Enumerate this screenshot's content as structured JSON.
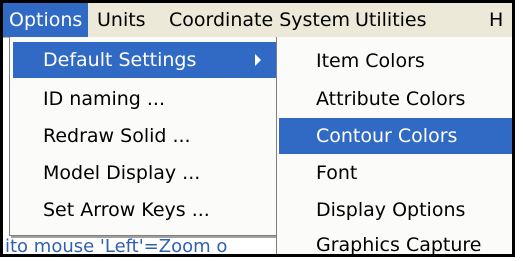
{
  "menubar": {
    "items": [
      {
        "label": "Options"
      },
      {
        "label": "Units"
      },
      {
        "label": "Coordinate System"
      },
      {
        "label": "Utilities"
      },
      {
        "label": "H"
      }
    ]
  },
  "options_menu": {
    "items": [
      {
        "label": "Default Settings"
      },
      {
        "label": "ID naming ..."
      },
      {
        "label": "Redraw Solid ..."
      },
      {
        "label": "Model Display ..."
      },
      {
        "label": "Set Arrow Keys ..."
      }
    ]
  },
  "default_settings_submenu": {
    "items": [
      {
        "label": "Item Colors"
      },
      {
        "label": "Attribute Colors"
      },
      {
        "label": "Contour Colors"
      },
      {
        "label": "Font"
      },
      {
        "label": "Display Options"
      },
      {
        "label": "Graphics Capture"
      }
    ]
  },
  "statusbar": {
    "text": "ito mouse  'Left'=Zoom o"
  },
  "colors": {
    "highlight": "#316ac5",
    "menubar_bg": "#ece9d8",
    "menu_bg": "#fbfbf9"
  }
}
